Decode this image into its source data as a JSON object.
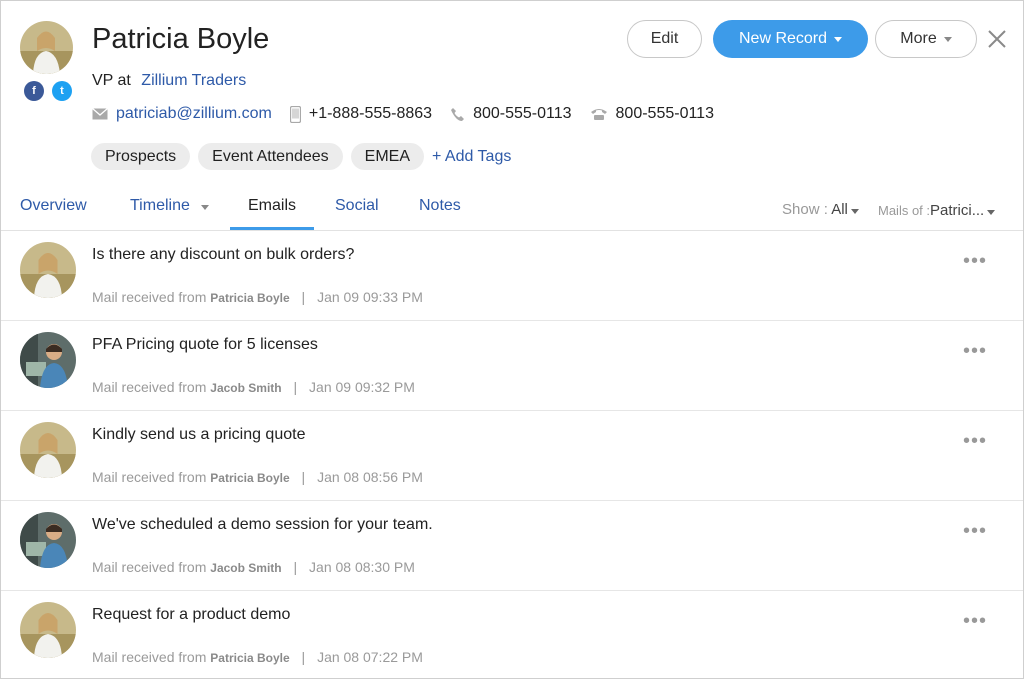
{
  "contact": {
    "name": "Patricia Boyle",
    "role_prefix": "VP at",
    "company": "Zillium Traders",
    "email": "patriciab@zillium.com",
    "mobile": "+1-888-555-8863",
    "phone": "800-555-0113",
    "fax": "800-555-0113"
  },
  "social": {
    "facebook": "f",
    "twitter": "t"
  },
  "tags": [
    "Prospects",
    "Event Attendees",
    "EMEA"
  ],
  "add_tags_label": "+ Add Tags",
  "buttons": {
    "edit": "Edit",
    "new_record": "New Record",
    "more": "More"
  },
  "tabs": {
    "overview": "Overview",
    "timeline": "Timeline",
    "emails": "Emails",
    "social": "Social",
    "notes": "Notes"
  },
  "filters": {
    "show_label": "Show :",
    "show_value": "All",
    "mails_of_label": "Mails of :",
    "mails_of_value": "Patrici..."
  },
  "emails": [
    {
      "subject": "Is there any discount on bulk orders?",
      "prefix": "Mail received from",
      "sender": "Patricia Boyle",
      "time": "Jan 09 09:33 PM",
      "avatar": "patricia"
    },
    {
      "subject": "PFA Pricing quote for 5 licenses",
      "prefix": "Mail received from",
      "sender": "Jacob Smith",
      "time": "Jan 09 09:32 PM",
      "avatar": "jacob"
    },
    {
      "subject": "Kindly send us a pricing quote",
      "prefix": "Mail received from",
      "sender": "Patricia Boyle",
      "time": "Jan 08 08:56 PM",
      "avatar": "patricia"
    },
    {
      "subject": "We've scheduled a demo session for your team.",
      "prefix": "Mail received from",
      "sender": "Jacob Smith",
      "time": "Jan 08 08:30 PM",
      "avatar": "jacob"
    },
    {
      "subject": "Request for a product demo",
      "prefix": "Mail received from",
      "sender": "Patricia Boyle",
      "time": "Jan 08 07:22 PM",
      "avatar": "patricia"
    }
  ],
  "colors": {
    "accent": "#3d9be9",
    "link": "#2e5aa8",
    "facebook": "#3b5998",
    "twitter": "#1da1f2"
  },
  "icons": {
    "email": "envelope-icon",
    "mobile": "mobile-phone-icon",
    "phone": "phone-icon",
    "fax": "telephone-icon",
    "close": "close-icon",
    "row_menu": "more-dots-icon"
  }
}
